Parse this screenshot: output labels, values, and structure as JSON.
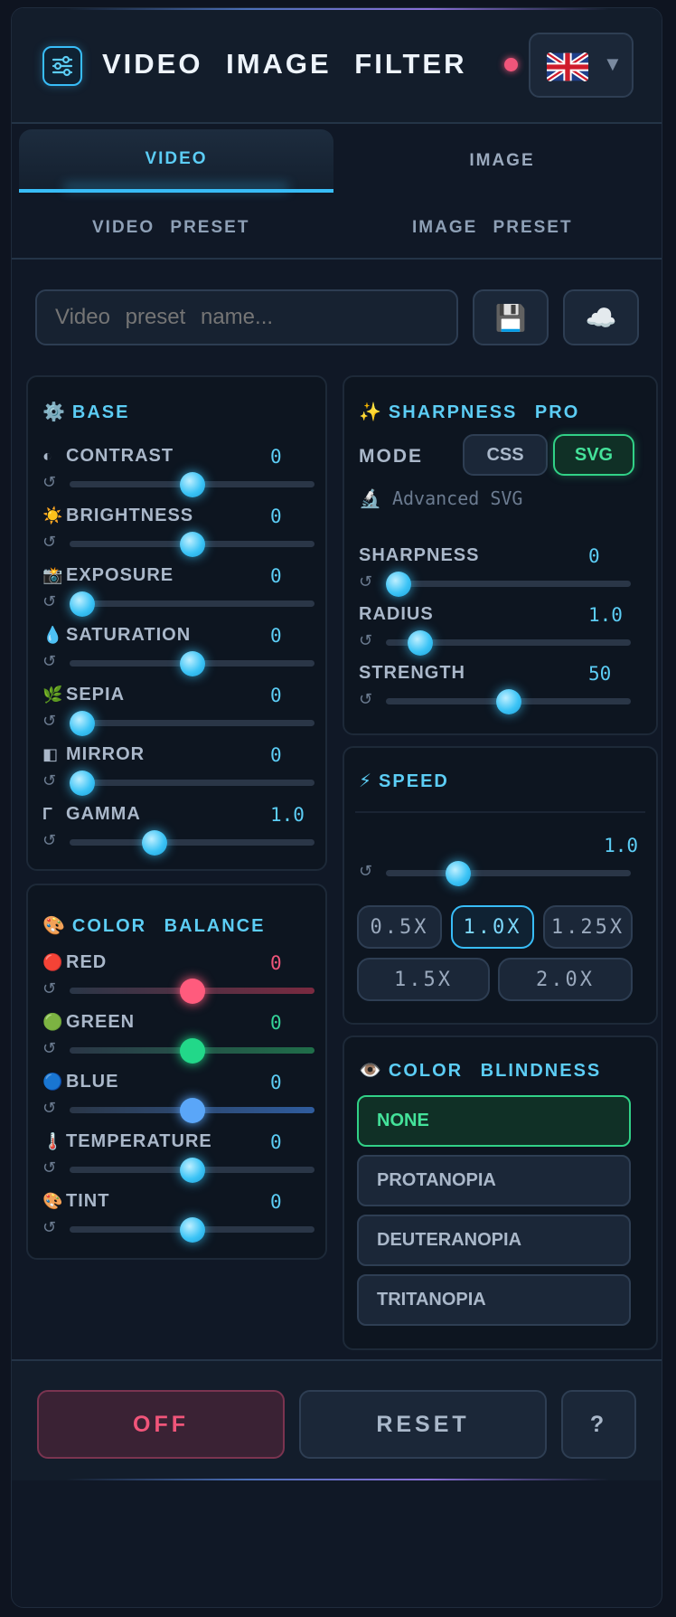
{
  "header": {
    "title": "VIDEO IMAGE FILTER",
    "status_color": "#f0557a",
    "language": {
      "flag": "UK",
      "caret": "▼"
    }
  },
  "tabs": [
    {
      "label": "VIDEO",
      "active": true
    },
    {
      "label": "IMAGE",
      "active": false
    }
  ],
  "preset_tabs": [
    "VIDEO PRESET",
    "IMAGE PRESET"
  ],
  "preset": {
    "placeholder": "Video preset name...",
    "save_icon": "💾",
    "cloud_icon": "☁️"
  },
  "base": {
    "title": "BASE",
    "icon": "⚙️",
    "controls": [
      {
        "icon": "◐",
        "label": "CONTRAST",
        "value": "0",
        "level": 0.5
      },
      {
        "icon": "☀️",
        "label": "BRIGHTNESS",
        "value": "0",
        "level": 0.5
      },
      {
        "icon": "📸",
        "label": "EXPOSURE",
        "value": "0",
        "level": 0.0
      },
      {
        "icon": "💧",
        "label": "SATURATION",
        "value": "0",
        "level": 0.5
      },
      {
        "icon": "🌿",
        "label": "SEPIA",
        "value": "0",
        "level": 0.0
      },
      {
        "icon": "◧",
        "label": "MIRROR",
        "value": "0",
        "level": 0.0
      },
      {
        "icon": "Γ",
        "label": "GAMMA",
        "value": "1.0",
        "level": 0.33
      }
    ]
  },
  "color_balance": {
    "title": "COLOR BALANCE",
    "icon": "🎨",
    "controls": [
      {
        "icon": "🔴",
        "label": "RED",
        "value": "0",
        "level": 0.5,
        "value_color": "#f0557a",
        "thumb": "#ff5b7d",
        "track": "linear-gradient(90deg,#2a3647,#7a2a40)"
      },
      {
        "icon": "🟢",
        "label": "GREEN",
        "value": "0",
        "level": 0.5,
        "value_color": "#34d399",
        "thumb": "#22d889",
        "track": "linear-gradient(90deg,#2a3647,#1f6e49)"
      },
      {
        "icon": "🔵",
        "label": "BLUE",
        "value": "0",
        "level": 0.5,
        "value_color": "#5ccdf5",
        "thumb": "#5aa6f8",
        "track": "linear-gradient(90deg,#2a3647,#2f5c9e)"
      },
      {
        "icon": "🌡️",
        "label": "TEMPERATURE",
        "value": "0",
        "level": 0.5,
        "value_color": "#5ccdf5"
      },
      {
        "icon": "🎨",
        "label": "TINT",
        "value": "0",
        "level": 0.5,
        "value_color": "#5ccdf5"
      }
    ]
  },
  "sharpness": {
    "title": "SHARPNESS PRO",
    "icon": "✨",
    "mode_label": "MODE",
    "modes": [
      "CSS",
      "SVG"
    ],
    "active_mode": "SVG",
    "advanced_label": "Advanced SVG",
    "advanced_icon": "🔬",
    "controls": [
      {
        "label": "SHARPNESS",
        "value": "0",
        "level": 0.0
      },
      {
        "label": "RADIUS",
        "value": "1.0",
        "level": 0.1
      },
      {
        "label": "STRENGTH",
        "value": "50",
        "level": 0.5
      }
    ]
  },
  "speed": {
    "title": "SPEED",
    "icon": "⚡",
    "value": "1.0",
    "level": 0.27,
    "options": [
      "0.5X",
      "1.0X",
      "1.25X",
      "1.5X",
      "2.0X"
    ],
    "active": "1.0X"
  },
  "color_blindness": {
    "title": "COLOR BLINDNESS",
    "icon": "👁️",
    "options": [
      "NONE",
      "PROTANOPIA",
      "DEUTERANOPIA",
      "TRITANOPIA"
    ],
    "active": "NONE"
  },
  "footer": {
    "off_label": "OFF",
    "reset_label": "RESET",
    "help_label": "?"
  },
  "reset_glyph": "↺",
  "colors": {
    "accent": "#38bdf8",
    "active_green": "#31d187",
    "danger": "#f0557a"
  }
}
